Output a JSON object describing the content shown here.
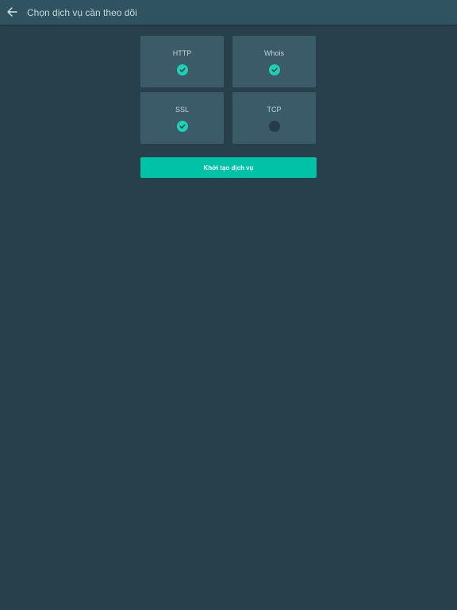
{
  "header": {
    "title": "Chọn dịch vụ cần theo dõi",
    "back_icon": "arrow-left-icon"
  },
  "services": [
    {
      "label": "HTTP",
      "selected": true
    },
    {
      "label": "Whois",
      "selected": true
    },
    {
      "label": "SSL",
      "selected": true
    },
    {
      "label": "TCP",
      "selected": false
    }
  ],
  "submit": {
    "label": "Khởi tạo dịch vụ"
  },
  "colors": {
    "background": "#27404c",
    "topbar": "#2f5360",
    "card": "#3c5b68",
    "accent": "#00c2a6",
    "check_on": "#1fd0b6",
    "check_off": "#263c48"
  }
}
